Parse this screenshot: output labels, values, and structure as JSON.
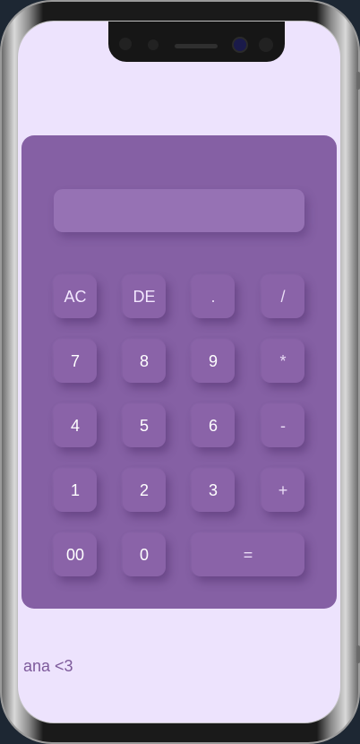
{
  "calculator": {
    "display_value": "",
    "keys": {
      "ac": "AC",
      "de": "DE",
      "dot": ".",
      "divide": "/",
      "seven": "7",
      "eight": "8",
      "nine": "9",
      "multiply": "*",
      "four": "4",
      "five": "5",
      "six": "6",
      "minus": "-",
      "one": "1",
      "two": "2",
      "three": "3",
      "plus": "+",
      "double_zero": "00",
      "zero": "0",
      "equals": "="
    }
  },
  "footer": {
    "text": "ana <3"
  },
  "colors": {
    "page_background": "#ede3fd",
    "calculator_background": "#8560a4",
    "display_background": "#9672b4",
    "key_background": "#8a63a8",
    "footer_text": "#7d5a9b"
  }
}
